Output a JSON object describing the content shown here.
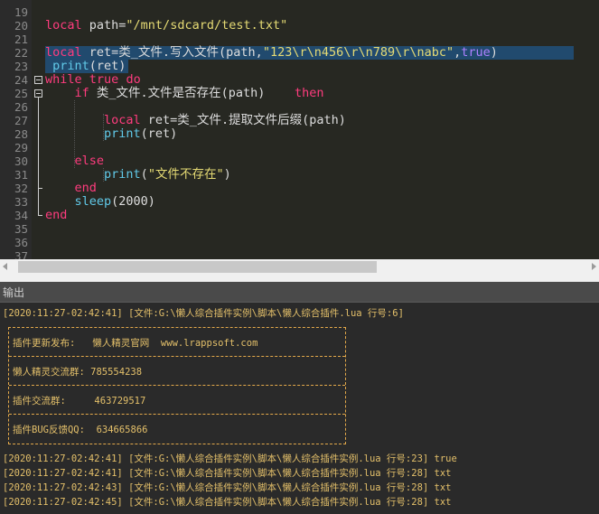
{
  "editor": {
    "line_numbers": [
      "19",
      "20",
      "21",
      "22",
      "23",
      "24",
      "25",
      "26",
      "27",
      "28",
      "29",
      "30",
      "31",
      "32",
      "33",
      "34",
      "35",
      "36",
      "37"
    ],
    "lines": {
      "l20": [
        {
          "c": "k",
          "t": "local"
        },
        {
          "c": "v",
          "t": " path="
        },
        {
          "c": "s",
          "t": "\"/mnt/sdcard/test.txt\""
        }
      ],
      "l22": [
        {
          "c": "k",
          "t": "local"
        },
        {
          "c": "v",
          "t": " ret=类_文件.写入文件(path,"
        },
        {
          "c": "s",
          "t": "\"123\\r\\n456\\r\\n789\\r\\nabc\""
        },
        {
          "c": "v",
          "t": ","
        },
        {
          "c": "n",
          "t": "true"
        },
        {
          "c": "v",
          "t": ")"
        }
      ],
      "l23": [
        {
          "c": "f",
          "t": " print"
        },
        {
          "c": "v",
          "t": "(ret)"
        }
      ],
      "l24": [
        {
          "c": "k",
          "t": "while"
        },
        {
          "c": "v",
          "t": " "
        },
        {
          "c": "k",
          "t": "true"
        },
        {
          "c": "v",
          "t": " "
        },
        {
          "c": "k",
          "t": "do"
        }
      ],
      "l25": [
        {
          "c": "k",
          "t": "    if"
        },
        {
          "c": "v",
          "t": " 类_文件.文件是否存在(path)    "
        },
        {
          "c": "k",
          "t": "then"
        }
      ],
      "l27": [
        {
          "c": "k",
          "t": "        local"
        },
        {
          "c": "v",
          "t": " ret=类_文件.提取文件后缀(path)"
        }
      ],
      "l28": [
        {
          "c": "f",
          "t": "        print"
        },
        {
          "c": "v",
          "t": "(ret)"
        }
      ],
      "l30": [
        {
          "c": "k",
          "t": "    else"
        }
      ],
      "l31": [
        {
          "c": "f",
          "t": "        print"
        },
        {
          "c": "v",
          "t": "("
        },
        {
          "c": "s",
          "t": "\"文件不存在\""
        },
        {
          "c": "v",
          "t": ")"
        }
      ],
      "l32": [
        {
          "c": "k",
          "t": "    end"
        }
      ],
      "l33": [
        {
          "c": "f",
          "t": "    sleep"
        },
        {
          "c": "v",
          "t": "(2000)"
        }
      ],
      "l34": [
        {
          "c": "k",
          "t": "end"
        }
      ]
    }
  },
  "output": {
    "title": "输出",
    "first_line": "[2020:11:27-02:42:41] [文件:G:\\懒人综合插件实例\\脚本\\懒人综合插件.lua 行号:6]",
    "ad_lines": [
      "插件更新发布:   懒人精灵官网  www.lrappsoft.com",
      "懒人精灵交流群: 785554238",
      "插件交流群:     463729517",
      "插件BUG反馈QQ:  634665866"
    ],
    "log_lines": [
      "[2020:11:27-02:42:41] [文件:G:\\懒人综合插件实例\\脚本\\懒人综合插件实例.lua 行号:23] true",
      "[2020:11:27-02:42:41] [文件:G:\\懒人综合插件实例\\脚本\\懒人综合插件实例.lua 行号:28] txt",
      "[2020:11:27-02:42:43] [文件:G:\\懒人综合插件实例\\脚本\\懒人综合插件实例.lua 行号:28] txt",
      "[2020:11:27-02:42:45] [文件:G:\\懒人综合插件实例\\脚本\\懒人综合插件实例.lua 行号:28] txt"
    ]
  }
}
